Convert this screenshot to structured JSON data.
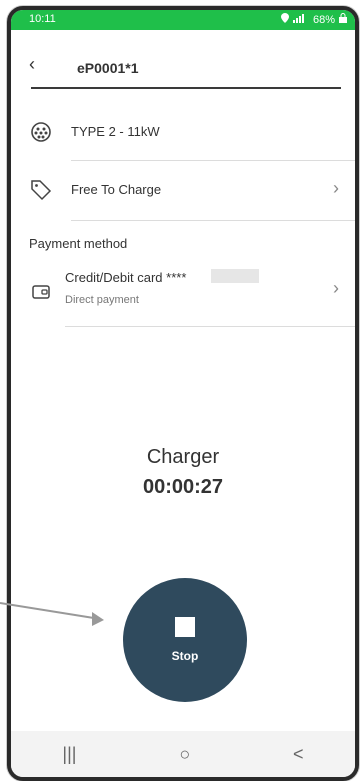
{
  "statusbar": {
    "time": "10:11",
    "battery": "68%"
  },
  "header": {
    "title": "eP0001*1"
  },
  "connector": {
    "label": "TYPE 2 - 11kW"
  },
  "tariff": {
    "label": "Free To Charge"
  },
  "payment": {
    "section_title": "Payment method",
    "method_label": "Credit/Debit card ****",
    "method_sub": "Direct payment"
  },
  "session": {
    "charger_label": "Charger",
    "timer": "00:00:27"
  },
  "stop": {
    "label": "Stop"
  },
  "colors": {
    "status_green": "#1fbf4a",
    "stop_button": "#2f4a5d"
  },
  "navbar": {
    "recent": "|||",
    "home": "○",
    "back": "<"
  }
}
